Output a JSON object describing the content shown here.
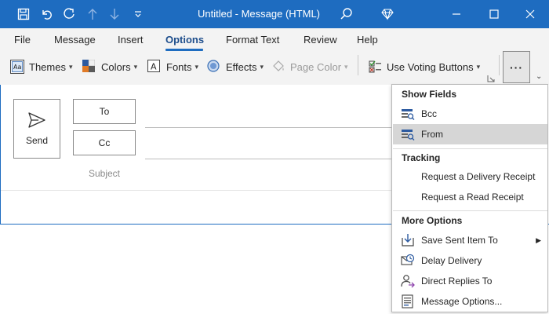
{
  "window": {
    "title": "Untitled  -  Message (HTML)",
    "accent_color": "#1e6cc0"
  },
  "quick_access": [
    "save-icon",
    "undo-icon",
    "redo-icon",
    "up-arrow-icon",
    "down-arrow-icon",
    "customize-icon"
  ],
  "tabs": [
    {
      "label": "File"
    },
    {
      "label": "Message"
    },
    {
      "label": "Insert"
    },
    {
      "label": "Options"
    },
    {
      "label": "Format Text"
    },
    {
      "label": "Review"
    },
    {
      "label": "Help"
    }
  ],
  "active_tab": "Options",
  "toolbar": {
    "themes": "Themes",
    "colors": "Colors",
    "fonts": "Fonts",
    "effects": "Effects",
    "page_color": "Page Color",
    "voting": "Use Voting Buttons",
    "more": "···"
  },
  "compose": {
    "send": "Send",
    "to": "To",
    "cc": "Cc",
    "subject": "Subject"
  },
  "dropdown": {
    "show_fields": "Show Fields",
    "bcc": "Bcc",
    "from": "From",
    "tracking": "Tracking",
    "delivery_receipt": "Request a Delivery Receipt",
    "read_receipt": "Request a Read Receipt",
    "more_options": "More Options",
    "save_sent": "Save Sent Item To",
    "delay": "Delay Delivery",
    "direct_replies": "Direct Replies To",
    "message_options": "Message Options..."
  }
}
